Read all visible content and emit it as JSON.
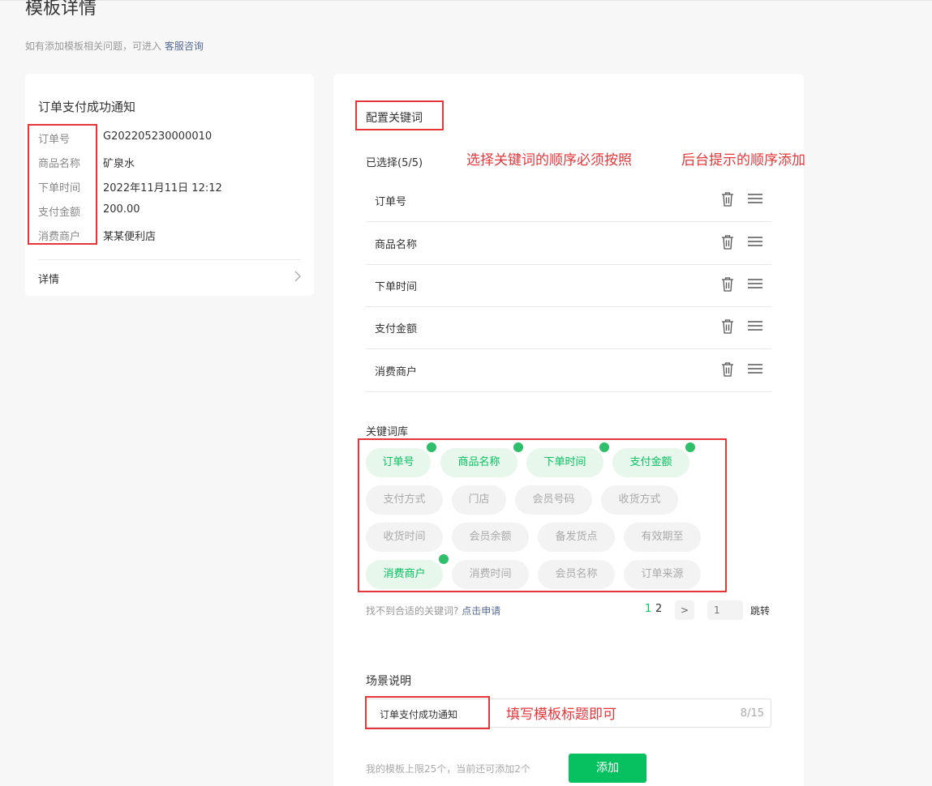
{
  "header": {
    "title": "模板详情",
    "subtitle_prefix": "如有添加模板相关问题，可进入",
    "subtitle_link": "客服咨询"
  },
  "preview": {
    "title": "订单支付成功通知",
    "fields": [
      {
        "label": "订单号",
        "value": "G202205230000010"
      },
      {
        "label": "商品名称",
        "value": "矿泉水"
      },
      {
        "label": "下单时间",
        "value": "2022年11月11日 12:12"
      },
      {
        "label": "支付金额",
        "value": "200.00"
      },
      {
        "label": "消费商户",
        "value": "某某便利店"
      }
    ],
    "detail_label": "详情"
  },
  "config": {
    "title": "配置关键词",
    "selected_label": "已选择(5/5)",
    "annotation_1": "选择关键词的顺序必须按照",
    "annotation_2": "后台提示的顺序添加",
    "selected": [
      "订单号",
      "商品名称",
      "下单时间",
      "支付金额",
      "消费商户"
    ]
  },
  "library": {
    "title": "关键词库",
    "tags": [
      {
        "label": "订单号",
        "selected": true
      },
      {
        "label": "商品名称",
        "selected": true
      },
      {
        "label": "下单时间",
        "selected": true
      },
      {
        "label": "支付金额",
        "selected": true
      },
      {
        "label": "支付方式",
        "selected": false
      },
      {
        "label": "门店",
        "selected": false
      },
      {
        "label": "会员号码",
        "selected": false
      },
      {
        "label": "收货方式",
        "selected": false
      },
      {
        "label": "收货时间",
        "selected": false
      },
      {
        "label": "会员余额",
        "selected": false
      },
      {
        "label": "备发货点",
        "selected": false
      },
      {
        "label": "有效期至",
        "selected": false
      },
      {
        "label": "消费商户",
        "selected": true
      },
      {
        "label": "消费时间",
        "selected": false
      },
      {
        "label": "会员名称",
        "selected": false
      },
      {
        "label": "订单来源",
        "selected": false
      }
    ],
    "not_found_text": "找不到合适的关键词?",
    "apply_link": "点击申请",
    "pages": [
      "1",
      "2"
    ],
    "current_page": "1",
    "next_symbol": ">",
    "page_input_placeholder": "1",
    "jump_label": "跳转"
  },
  "scene": {
    "title": "场景说明",
    "value": "订单支付成功通知",
    "counter": "8/15",
    "annotation": "填写模板标题即可"
  },
  "footer": {
    "limit_text": "我的模板上限25个，当前还可添加2个",
    "add_label": "添加"
  },
  "colors": {
    "accent": "#07c160",
    "annotation_red": "#e5373b",
    "link": "#576b95"
  },
  "icons": {
    "delete": "trash-icon",
    "drag": "drag-handle-icon",
    "selected_tag": "check-icon",
    "detail": "chevron-right-icon"
  }
}
